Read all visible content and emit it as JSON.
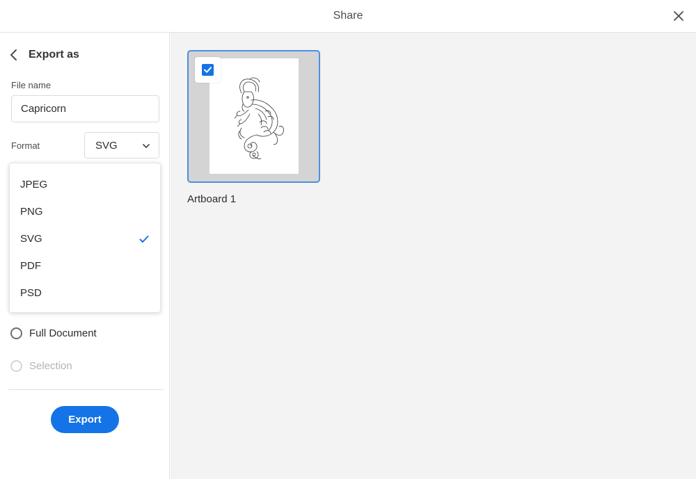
{
  "header": {
    "title": "Share",
    "close_icon": "close-icon"
  },
  "sidebar": {
    "title": "Export as",
    "back_icon": "chevron-left-icon",
    "file_name_label": "File name",
    "file_name_value": "Capricorn",
    "format_label": "Format",
    "format_value": "SVG",
    "format_options": [
      {
        "label": "JPEG",
        "selected": false
      },
      {
        "label": "PNG",
        "selected": false
      },
      {
        "label": "SVG",
        "selected": true
      },
      {
        "label": "PDF",
        "selected": false
      },
      {
        "label": "PSD",
        "selected": false
      }
    ],
    "scope_options": [
      {
        "label": "Full Document",
        "enabled": true,
        "selected": false
      },
      {
        "label": "Selection",
        "enabled": false,
        "selected": false
      }
    ],
    "export_label": "Export"
  },
  "main": {
    "artboards": [
      {
        "name": "Artboard 1",
        "checked": true
      }
    ]
  },
  "colors": {
    "accent": "#1473e6",
    "selection_border": "#4a90e2",
    "canvas_bg": "#f3f3f3"
  }
}
